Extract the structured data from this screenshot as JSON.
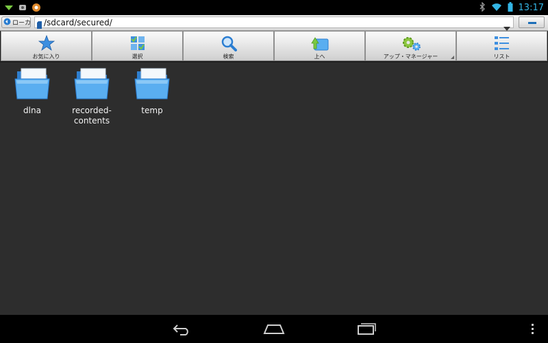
{
  "status": {
    "time": "13:17"
  },
  "address": {
    "location_label": "ローカ",
    "path": "/sdcard/secured/"
  },
  "toolbar": {
    "items": [
      {
        "label": "お気に入り",
        "icon": "star-icon"
      },
      {
        "label": "選択",
        "icon": "select-grid-icon"
      },
      {
        "label": "検索",
        "icon": "magnifier-icon"
      },
      {
        "label": "上へ",
        "icon": "up-folder-icon"
      },
      {
        "label": "アップ・マネージャー",
        "icon": "gears-icon"
      },
      {
        "label": "リスト",
        "icon": "list-icon"
      }
    ]
  },
  "folders": [
    {
      "name": "dlna"
    },
    {
      "name": "recorded-\ncontents"
    },
    {
      "name": "temp"
    }
  ],
  "colors": {
    "accent": "#33b5e5",
    "background": "#2d2d2d",
    "folder": "#5aaef0"
  }
}
